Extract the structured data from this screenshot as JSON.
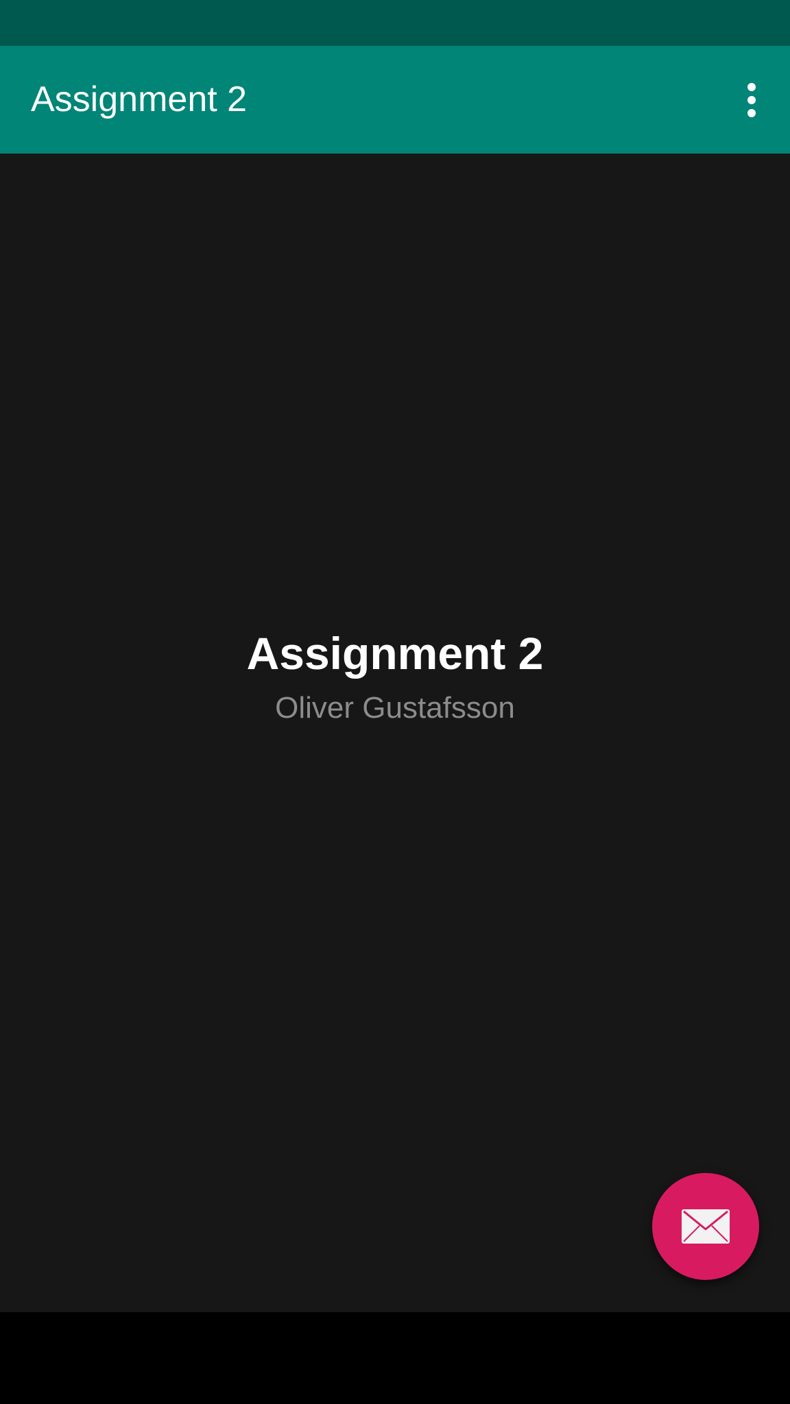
{
  "app_bar": {
    "title": "Assignment 2",
    "overflow_icon": "more-vert-icon"
  },
  "main": {
    "title": "Assignment 2",
    "subtitle": "Oliver Gustafsson"
  },
  "fab": {
    "icon": "envelope-icon"
  },
  "colors": {
    "status_bar": "#00594F",
    "app_bar": "#018577",
    "background": "#171717",
    "fab": "#D81B60",
    "title_text": "#FFFFFF",
    "subtitle_text": "#8C8C8C",
    "nav_bar": "#000000"
  }
}
